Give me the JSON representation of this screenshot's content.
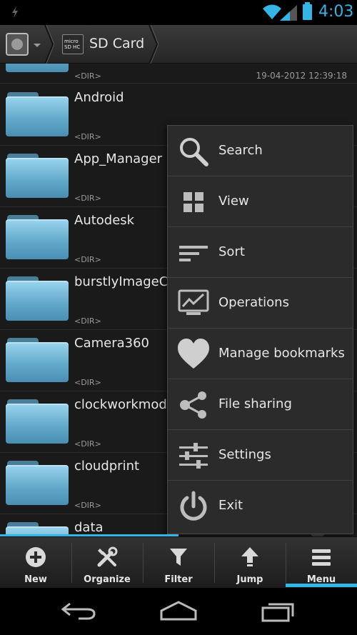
{
  "status_bar": {
    "time": "4:03",
    "accent_color": "#33b5e5"
  },
  "breadcrumb": {
    "location": "SD Card",
    "sd_icon_text": "micro SD HC"
  },
  "files": [
    {
      "name": "",
      "meta": "<DIR>",
      "date": "19-04-2012 12:39:18"
    },
    {
      "name": "Android",
      "meta": "<DIR>"
    },
    {
      "name": "App_Manager",
      "meta": "<DIR>"
    },
    {
      "name": "Autodesk",
      "meta": "<DIR>"
    },
    {
      "name": "burstlyImageCa",
      "meta": "<DIR>"
    },
    {
      "name": "Camera360",
      "meta": "<DIR>"
    },
    {
      "name": "clockworkmod",
      "meta": "<DIR>"
    },
    {
      "name": "cloudprint",
      "meta": "<DIR>"
    },
    {
      "name": "data",
      "meta": ""
    }
  ],
  "menu": {
    "items": [
      {
        "label": "Search",
        "icon": "search-icon"
      },
      {
        "label": "View",
        "icon": "view-grid-icon"
      },
      {
        "label": "Sort",
        "icon": "sort-icon"
      },
      {
        "label": "Operations",
        "icon": "operations-icon"
      },
      {
        "label": "Manage bookmarks",
        "icon": "heart-icon"
      },
      {
        "label": "File sharing",
        "icon": "share-icon"
      },
      {
        "label": "Settings",
        "icon": "settings-sliders-icon"
      },
      {
        "label": "Exit",
        "icon": "power-icon"
      }
    ]
  },
  "action_bar": {
    "items": [
      {
        "label": "New",
        "icon": "plus-circle-icon"
      },
      {
        "label": "Organize",
        "icon": "tools-icon"
      },
      {
        "label": "Filter",
        "icon": "filter-icon"
      },
      {
        "label": "Jump",
        "icon": "arrow-up-icon"
      },
      {
        "label": "Menu",
        "icon": "menu-icon"
      }
    ],
    "active": "Menu"
  }
}
